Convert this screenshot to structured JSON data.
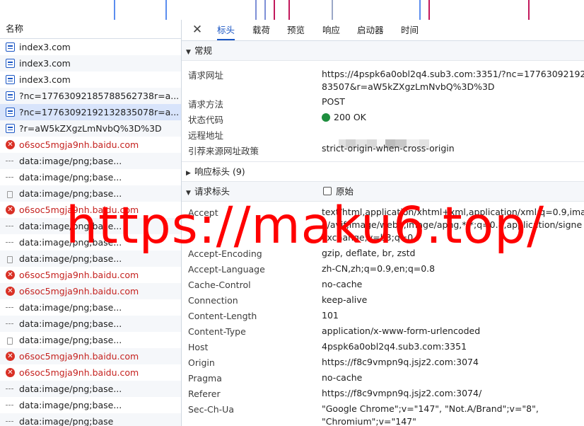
{
  "timeline": {
    "marks": [
      {
        "pos": 0.195,
        "color": "#5b8def"
      },
      {
        "pos": 0.283,
        "color": "#5b8def"
      },
      {
        "pos": 0.437,
        "color": "#7d8fd6"
      },
      {
        "pos": 0.453,
        "color": "#7d8fd6"
      },
      {
        "pos": 0.469,
        "color": "#c2185b"
      },
      {
        "pos": 0.494,
        "color": "#c2185b"
      },
      {
        "pos": 0.568,
        "color": "#9aa7c7"
      },
      {
        "pos": 0.718,
        "color": "#5b8def"
      },
      {
        "pos": 0.734,
        "color": "#c2185b"
      },
      {
        "pos": 0.904,
        "color": "#c2185b"
      }
    ]
  },
  "left": {
    "header": "名称",
    "rows": [
      {
        "label": "index3.com",
        "icon": "document-icon",
        "error": false
      },
      {
        "label": "index3.com",
        "icon": "document-icon",
        "error": false
      },
      {
        "label": "index3.com",
        "icon": "document-icon",
        "error": false
      },
      {
        "label": "?nc=17763092185788562738r=a...",
        "icon": "document-icon",
        "error": false
      },
      {
        "label": "?nc=17763092192132835078r=a...",
        "icon": "document-icon",
        "error": false,
        "selected": true
      },
      {
        "label": "?r=aW5kZXgzLmNvbQ%3D%3D",
        "icon": "document-icon",
        "error": false
      },
      {
        "label": "o6soc5mgja9nh.baidu.com",
        "icon": "error-icon",
        "error": true
      },
      {
        "label": "data:image/png;base...",
        "icon": "dash-icon",
        "error": false
      },
      {
        "label": "data:image/png;base...",
        "icon": "dash-icon",
        "error": false
      },
      {
        "label": "data:image/png;base...",
        "icon": "file-icon",
        "error": false
      },
      {
        "label": "o6soc5mgja9nh.baidu.com",
        "icon": "error-icon",
        "error": true
      },
      {
        "label": "data:image/png;base...",
        "icon": "dash-icon",
        "error": false
      },
      {
        "label": "data:image/png;base...",
        "icon": "dash-icon",
        "error": false
      },
      {
        "label": "data:image/png;base...",
        "icon": "file-icon",
        "error": false
      },
      {
        "label": "o6soc5mgja9nh.baidu.com",
        "icon": "error-icon",
        "error": true
      },
      {
        "label": "o6soc5mgja9nh.baidu.com",
        "icon": "error-icon",
        "error": true
      },
      {
        "label": "data:image/png;base...",
        "icon": "dash-icon",
        "error": false
      },
      {
        "label": "data:image/png;base...",
        "icon": "dash-icon",
        "error": false
      },
      {
        "label": "data:image/png;base...",
        "icon": "file-icon",
        "error": false
      },
      {
        "label": "o6soc5mgja9nh.baidu.com",
        "icon": "error-icon",
        "error": true
      },
      {
        "label": "o6soc5mgja9nh.baidu.com",
        "icon": "error-icon",
        "error": true
      },
      {
        "label": "data:image/png;base...",
        "icon": "dash-icon",
        "error": false
      },
      {
        "label": "data:image/png;base...",
        "icon": "dash-icon",
        "error": false
      },
      {
        "label": "data:image/png;base",
        "icon": "dash-icon",
        "error": false
      }
    ]
  },
  "tabs": {
    "close": "✕",
    "items": [
      "标头",
      "载荷",
      "预览",
      "响应",
      "启动器",
      "时间"
    ],
    "active": 0
  },
  "general": {
    "title": "常规",
    "url_label": "请求网址",
    "url_value": "https://4pspk6a0obl2q4.sub3.com:3351/?nc=17763092192\n83507&r=aW5kZXgzLmNvbQ%3D%3D",
    "method_label": "请求方法",
    "method_value": "POST",
    "status_label": "状态代码",
    "status_value": "200 OK",
    "remote_label": "远程地址",
    "policy_label": "引荐来源网址政策",
    "policy_value": "strict-origin-when-cross-origin"
  },
  "response_headers": {
    "title": "响应标头 (9)"
  },
  "request_headers": {
    "title": "请求标头",
    "raw_label": "原始",
    "items": [
      {
        "k": "Accept",
        "v": "text/html,application/xhtml+xml,application/xml;q=0.9,ima\ne/avif,image/webp,image/apng,*/*;q=0.8,application/signe\nexchange;v=b3;q=0.7",
        "lines": 3
      },
      {
        "k": "Accept-Encoding",
        "v": "gzip, deflate, br, zstd",
        "lines": 1
      },
      {
        "k": "Accept-Language",
        "v": "zh-CN,zh;q=0.9,en;q=0.8",
        "lines": 1
      },
      {
        "k": "Cache-Control",
        "v": "no-cache",
        "lines": 1
      },
      {
        "k": "Connection",
        "v": "keep-alive",
        "lines": 1
      },
      {
        "k": "Content-Length",
        "v": "101",
        "lines": 1
      },
      {
        "k": "Content-Type",
        "v": "application/x-www-form-urlencoded",
        "lines": 1
      },
      {
        "k": "Host",
        "v": "4pspk6a0obl2q4.sub3.com:3351",
        "lines": 1
      },
      {
        "k": "Origin",
        "v": "https://f8c9vmpn9q.jsjz2.com:3074",
        "lines": 1
      },
      {
        "k": "Pragma",
        "v": "no-cache",
        "lines": 1
      },
      {
        "k": "Referer",
        "v": "https://f8c9vmpn9q.jsjz2.com:3074/",
        "lines": 1
      },
      {
        "k": "Sec-Ch-Ua",
        "v": "\"Google Chrome\";v=\"147\", \"Not.A/Brand\";v=\"8\",\n\"Chromium\";v=\"147\"",
        "lines": 2
      }
    ]
  },
  "watermark": "https://maku6.top/",
  "colors": {
    "accent": "#1a56c4",
    "error": "#c5221f",
    "status_ok": "#1e8e3e",
    "watermark": "#ff0000"
  }
}
